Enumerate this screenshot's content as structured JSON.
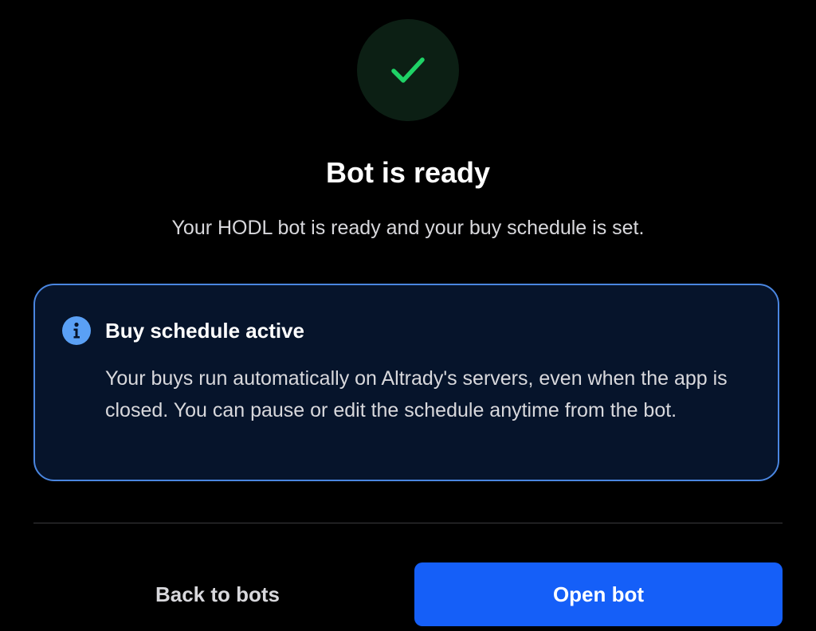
{
  "status": {
    "icon": "checkmark-icon",
    "icon_color": "#1fd266",
    "badge_color": "#0c1f14"
  },
  "header": {
    "title": "Bot is ready",
    "subtitle": "Your HODL bot is ready and your buy schedule is set."
  },
  "info_card": {
    "icon": "info-icon",
    "accent_color": "#4a86e0",
    "title": "Buy schedule active",
    "body": "Your buys run automatically on Altrady's servers, even when the app is closed. You can pause or edit the schedule anytime from the bot."
  },
  "actions": {
    "back_label": "Back to bots",
    "open_label": "Open bot",
    "primary_color": "#155ff8"
  }
}
